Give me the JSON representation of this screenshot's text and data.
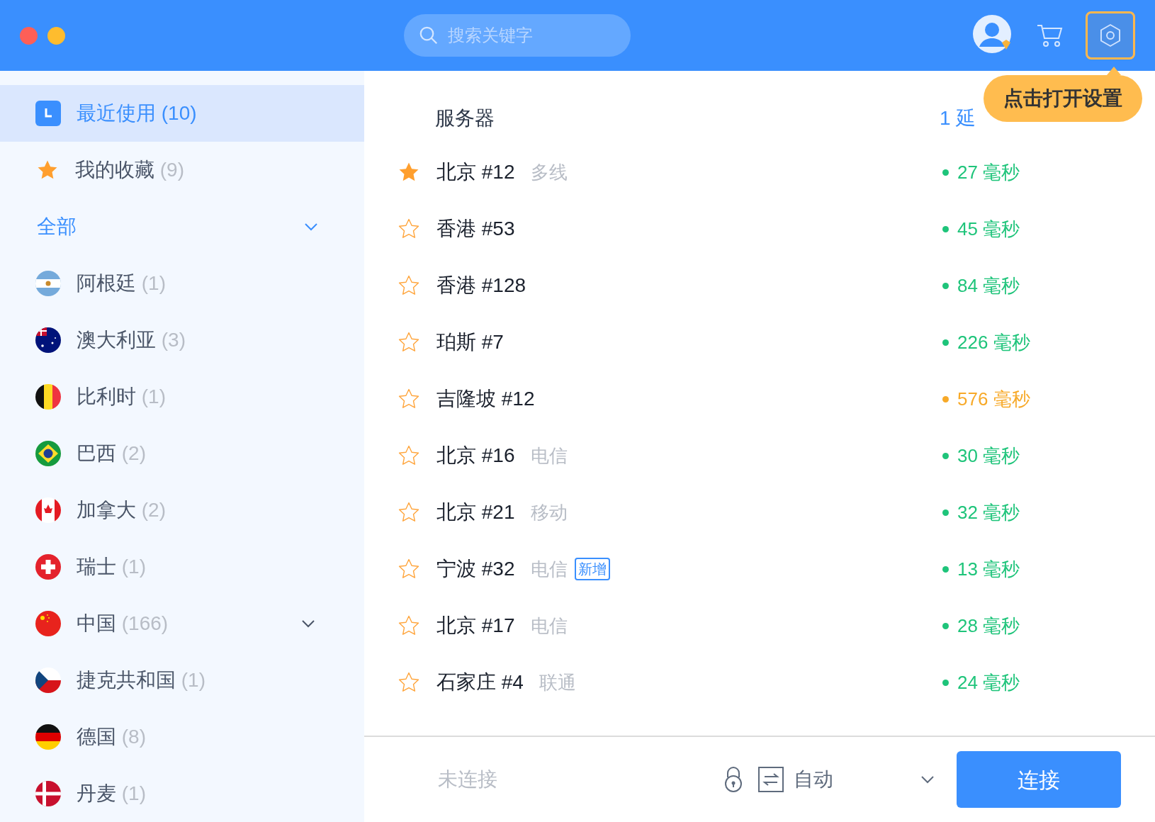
{
  "search": {
    "placeholder": "搜索关键字"
  },
  "tooltip": "点击打开设置",
  "sidebar": {
    "items": [
      {
        "kind": "recent",
        "label": "最近使用",
        "count": "(10)",
        "selected": true
      },
      {
        "kind": "favorites",
        "label": "我的收藏",
        "count": "(9)",
        "selected": false
      }
    ],
    "all": {
      "label": "全部",
      "expanded": true
    },
    "countries": [
      {
        "label": "阿根廷",
        "count": "(1)"
      },
      {
        "label": "澳大利亚",
        "count": "(3)"
      },
      {
        "label": "比利时",
        "count": "(1)"
      },
      {
        "label": "巴西",
        "count": "(2)"
      },
      {
        "label": "加拿大",
        "count": "(2)"
      },
      {
        "label": "瑞士",
        "count": "(1)"
      },
      {
        "label": "中国",
        "count": "(166)",
        "expandable": true
      },
      {
        "label": "捷克共和国",
        "count": "(1)"
      },
      {
        "label": "德国",
        "count": "(8)"
      },
      {
        "label": "丹麦",
        "count": "(1)"
      }
    ]
  },
  "table": {
    "columns": [
      "服务器",
      "1 延"
    ],
    "rows": [
      {
        "favorite": true,
        "name": "北京 #12",
        "line": "多线",
        "latency": "27 毫秒",
        "color": "#1ec47a"
      },
      {
        "favorite": false,
        "name": "香港 #53",
        "latency": "45 毫秒",
        "color": "#1ec47a"
      },
      {
        "favorite": false,
        "name": "香港 #128",
        "latency": "84 毫秒",
        "color": "#1ec47a"
      },
      {
        "favorite": false,
        "name": "珀斯 #7",
        "latency": "226 毫秒",
        "color": "#1ec47a"
      },
      {
        "favorite": false,
        "name": "吉隆坡 #12",
        "latency": "576 毫秒",
        "color": "#f7a928"
      },
      {
        "favorite": false,
        "name": "北京 #16",
        "line": "电信",
        "latency": "30 毫秒",
        "color": "#1ec47a"
      },
      {
        "favorite": false,
        "name": "北京 #21",
        "line": "移动",
        "latency": "32 毫秒",
        "color": "#1ec47a"
      },
      {
        "favorite": false,
        "name": "宁波 #32",
        "line": "电信",
        "badge": "新增",
        "latency": "13 毫秒",
        "color": "#1ec47a"
      },
      {
        "favorite": false,
        "name": "北京 #17",
        "line": "电信",
        "latency": "28 毫秒",
        "color": "#1ec47a"
      },
      {
        "favorite": false,
        "name": "石家庄 #4",
        "line": "联通",
        "latency": "24 毫秒",
        "color": "#1ec47a"
      }
    ]
  },
  "footer": {
    "status": "未连接",
    "protocol": "自动",
    "connect": "连接"
  }
}
